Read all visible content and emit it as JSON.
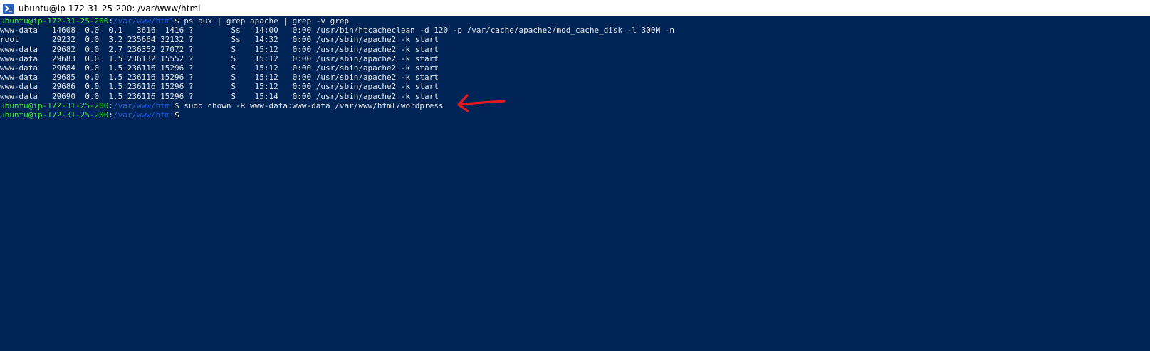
{
  "window": {
    "title": "ubuntu@ip-172-31-25-200: /var/www/html",
    "icon": "powershell-icon"
  },
  "prompt": {
    "user_host": "ubuntu@ip-172-31-25-200",
    "separator": ":",
    "path": "/var/www/html",
    "dollar": "$"
  },
  "commands": {
    "first": " ps aux | grep apache | grep -v grep",
    "second": " sudo chown -R www-data:www-data /var/www/html/wordpress",
    "third": ""
  },
  "output_lines": [
    "www-data   14608  0.0  0.1   3616  1416 ?        Ss   14:00   0:00 /usr/bin/htcacheclean -d 120 -p /var/cache/apache2/mod_cache_disk -l 300M -n",
    "root       29232  0.0  3.2 235664 32132 ?        Ss   14:32   0:00 /usr/sbin/apache2 -k start",
    "www-data   29682  0.0  2.7 236352 27072 ?        S    15:12   0:00 /usr/sbin/apache2 -k start",
    "www-data   29683  0.0  1.5 236132 15552 ?        S    15:12   0:00 /usr/sbin/apache2 -k start",
    "www-data   29684  0.0  1.5 236116 15296 ?        S    15:12   0:00 /usr/sbin/apache2 -k start",
    "www-data   29685  0.0  1.5 236116 15296 ?        S    15:12   0:00 /usr/sbin/apache2 -k start",
    "www-data   29686  0.0  1.5 236116 15296 ?        S    15:12   0:00 /usr/sbin/apache2 -k start",
    "www-data   29690  0.0  1.5 236116 15296 ?        S    15:14   0:00 /usr/sbin/apache2 -k start"
  ],
  "colors": {
    "background": "#012456",
    "prompt_user": "#3ce43c",
    "prompt_path": "#1f5fe6",
    "text": "#e6e6e6",
    "annotation_arrow": "#e0191f"
  },
  "annotation": {
    "icon": "red-arrow-icon"
  }
}
